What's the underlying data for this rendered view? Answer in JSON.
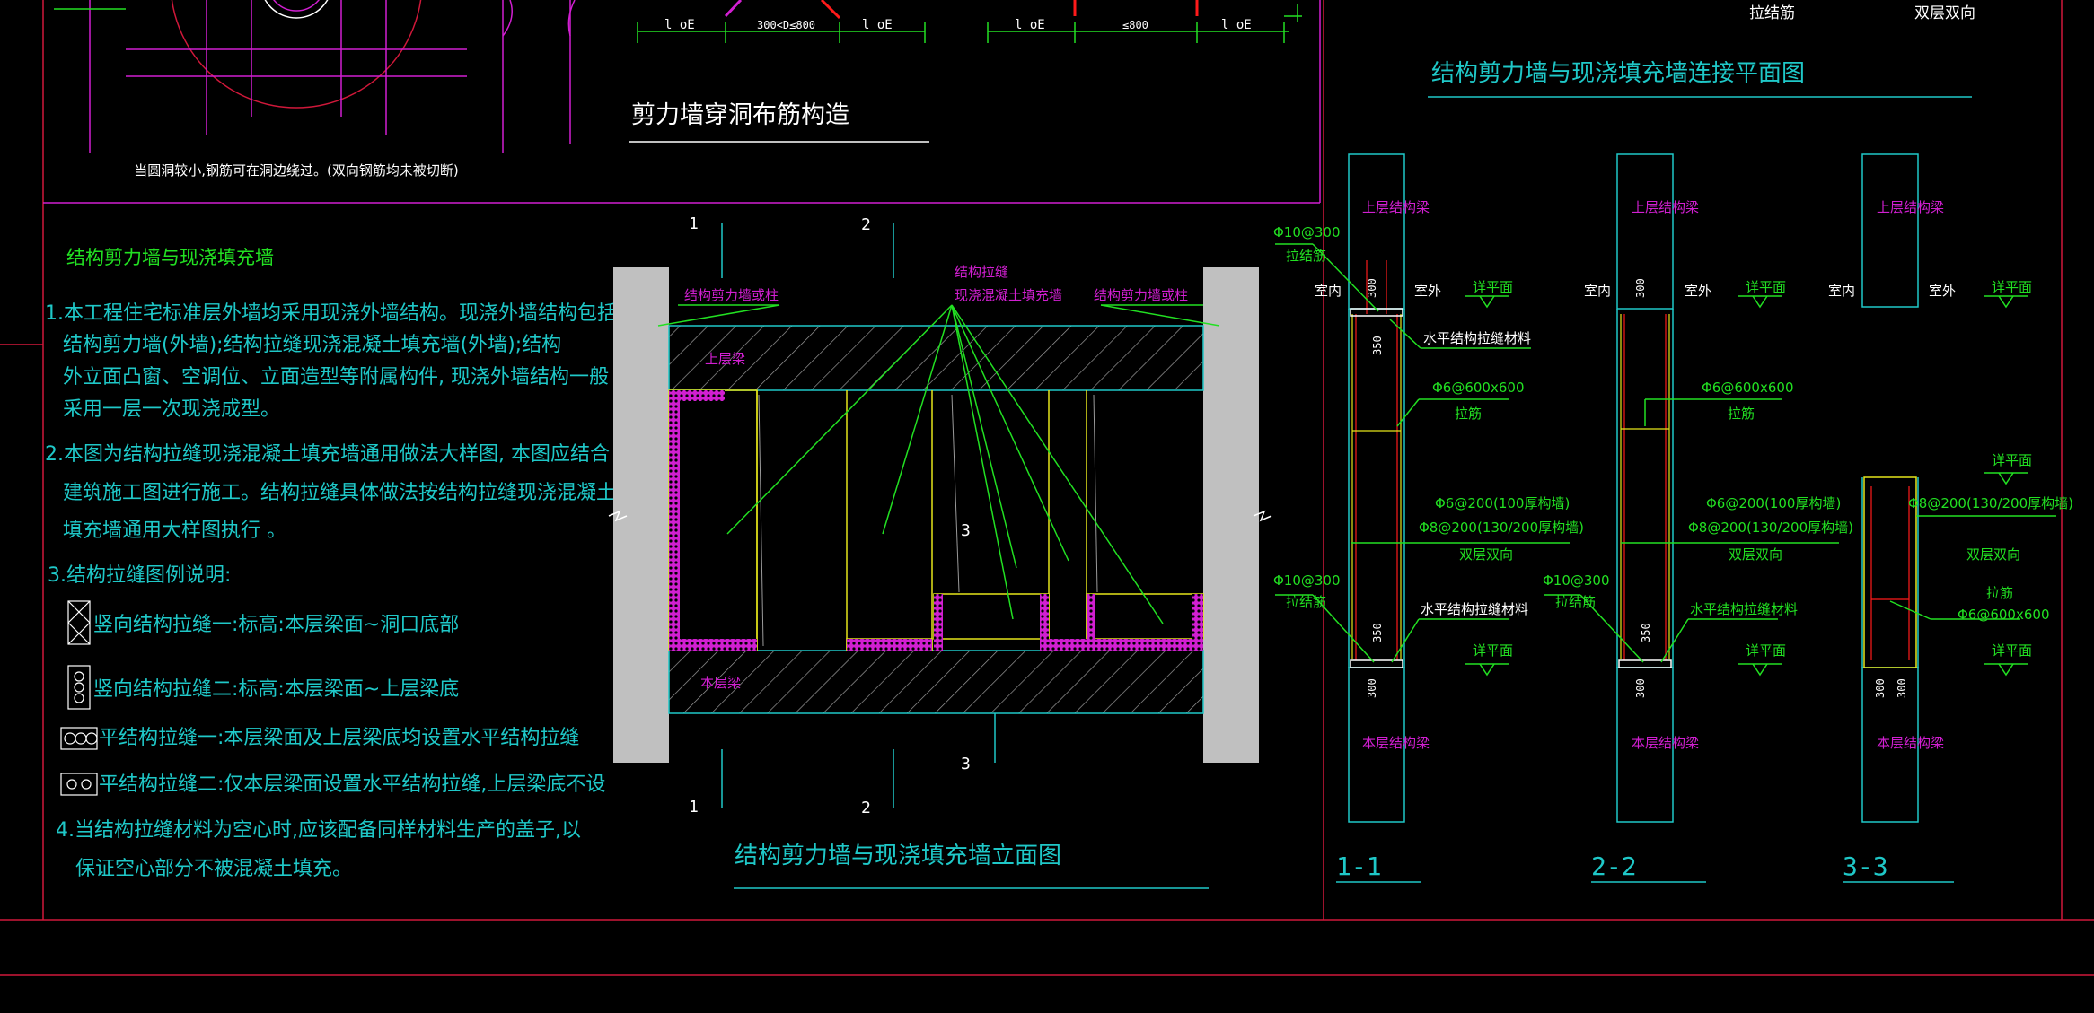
{
  "colors": {
    "background": "#000000",
    "frame_red": "#d0183a",
    "magenta": "#d11fd1",
    "cyan": "#1fc8c8",
    "green": "#22e022",
    "yellow": "#e6e61a",
    "white": "#ffffff",
    "grey_wall": "#c0c0c0",
    "red": "#ff1a1a"
  },
  "top_left": {
    "note": "当圆洞较小,钢筋可在洞边绕过。(双向钢筋均未被切断)"
  },
  "hole_detail": {
    "title": "剪力墙穿洞布筋构造",
    "dims_left": [
      "l oE",
      "300<D≤800",
      "l oE"
    ],
    "dims_right": [
      "l oE",
      "≤800",
      "l oE"
    ]
  },
  "top_right_labels": {
    "tie": "拉结筋",
    "double": "双层双向"
  },
  "notes": {
    "heading": "结构剪力墙与现浇填充墙",
    "p1": [
      "1.本工程住宅标准层外墙均采用现浇外墙结构。现浇外墙结构包括",
      "结构剪力墙(外墙);结构拉缝现浇混凝土填充墙(外墙);结构",
      "外立面凸窗、空调位、立面造型等附属构件, 现浇外墙结构一般",
      "采用一层一次现浇成型。"
    ],
    "p2": [
      "2.本图为结构拉缝现浇混凝土填充墙通用做法大样图, 本图应结合",
      "建筑施工图进行施工。结构拉缝具体做法按结构拉缝现浇混凝土",
      "填充墙通用大样图执行 。"
    ],
    "p3": "3.结构拉缝图例说明:",
    "legend": [
      "竖向结构拉缝一:标高:本层梁面~洞口底部",
      "竖向结构拉缝二:标高:本层梁面~上层梁底",
      "平结构拉缝一:本层梁面及上层梁底均设置水平结构拉缝",
      "平结构拉缝二:仅本层梁面设置水平结构拉缝,上层梁底不设"
    ],
    "p4": [
      "4.当结构拉缝材料为空心时,应该配备同样材料生产的盖子,以",
      "保证空心部分不被混凝土填充。"
    ]
  },
  "elevation": {
    "title": "结构剪力墙与现浇填充墙立面图",
    "label_left_wall": "结构剪力墙或柱",
    "label_right_wall": "结构剪力墙或柱",
    "label_center_1": "结构拉缝",
    "label_center_2": "现浇混凝土填充墙",
    "upper_beam": "上层梁",
    "lower_beam": "本层梁",
    "sec_1": "1",
    "sec_2": "2",
    "sec_3": "3"
  },
  "plan_title": "结构剪力墙与现浇填充墙连接平面图",
  "sections": [
    {
      "name": "1-1",
      "upper_beam": "上层结构梁",
      "lower_beam": "本层结构梁",
      "inside": "室内",
      "outside": "室外",
      "dim_top": "300",
      "dim_350": "350",
      "dim_bottom": "300",
      "leaders": [
        "Φ10@300",
        "拉结筋",
        "水平结构拉缝材料",
        "Φ6@600x600",
        "拉筋",
        "Φ6@200(100厚构墙)",
        "Φ8@200(130/200厚构墙)",
        "双层双向",
        "Φ10@300",
        "拉结筋",
        "水平结构拉缝材料"
      ],
      "level_mark": "详平面"
    },
    {
      "name": "2-2",
      "upper_beam": "上层结构梁",
      "lower_beam": "本层结构梁",
      "inside": "室内",
      "outside": "室外",
      "dim_top": "300",
      "dim_350": "350",
      "dim_bottom": "300",
      "leaders": [
        "Φ6@600x600",
        "拉筋",
        "Φ6@200(100厚构墙)",
        "Φ8@200(130/200厚构墙)",
        "双层双向",
        "Φ10@300",
        "拉结筋",
        "水平结构拉缝材料"
      ],
      "level_mark": "详平面"
    },
    {
      "name": "3-3",
      "upper_beam": "上层结构梁",
      "lower_beam": "本层结构梁",
      "inside": "室内",
      "outside": "室外",
      "dim_bottom": "300",
      "leaders": [
        "Φ8@200(130/200厚构墙)",
        "双层双向",
        "拉筋",
        "Φ6@600x600"
      ],
      "level_mark": "详平面"
    }
  ]
}
